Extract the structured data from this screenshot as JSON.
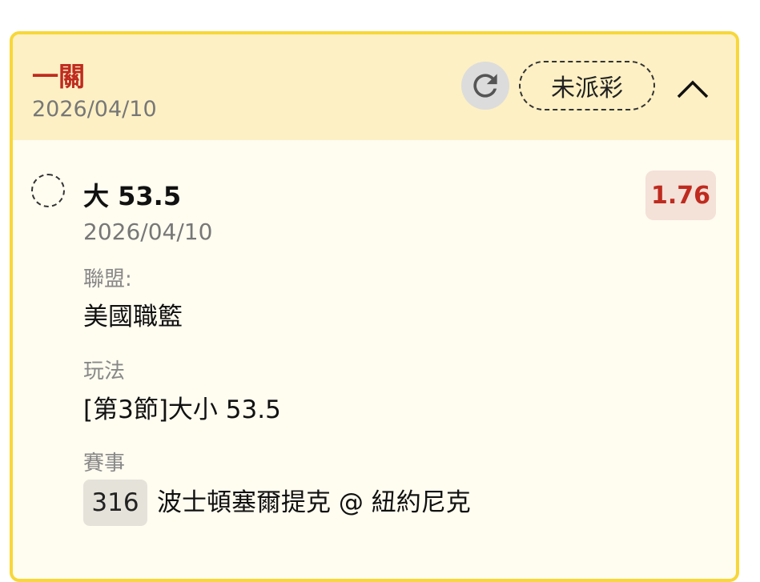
{
  "header": {
    "bet_type": "一關",
    "date": "2026/04/10",
    "status": "未派彩"
  },
  "icons": {
    "refresh": "refresh-icon",
    "collapse": "chevron-up-icon",
    "select": "dashed-circle-icon"
  },
  "colors": {
    "border": "#f7d739",
    "header_bg": "#fdf0c4",
    "body_bg": "#fffcf0",
    "accent_red": "#bf2b1f",
    "odds_bg": "#f4e1d8"
  },
  "selection": {
    "name": "大 53.5",
    "date": "2026/04/10",
    "odds": "1.76"
  },
  "details": {
    "league_label": "聯盟:",
    "league_value": "美國職籃",
    "market_label": "玩法",
    "market_value": "[第3節]大小 53.5",
    "event_label": "賽事",
    "event_code": "316",
    "event_name": "波士頓塞爾提克 @ 紐約尼克"
  }
}
